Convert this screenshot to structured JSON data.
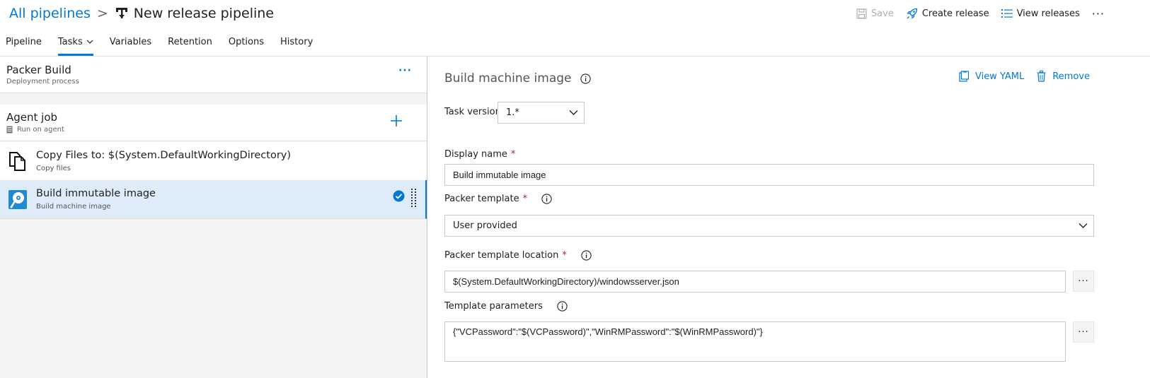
{
  "header": {
    "breadcrumb_root": "All pipelines",
    "breadcrumb_sep": ">",
    "title": "New release pipeline",
    "commands": {
      "save": "Save",
      "create_release": "Create release",
      "view_releases": "View releases",
      "more": "···"
    },
    "tabs": [
      {
        "label": "Pipeline"
      },
      {
        "label": "Tasks",
        "active": true
      },
      {
        "label": "Variables"
      },
      {
        "label": "Retention"
      },
      {
        "label": "Options"
      },
      {
        "label": "History"
      }
    ]
  },
  "left": {
    "process": {
      "title": "Packer Build",
      "subtitle": "Deployment process",
      "more": "···"
    },
    "agent_job": {
      "title": "Agent job",
      "subtitle": "Run on agent"
    },
    "tasks": [
      {
        "title": "Copy Files to: $(System.DefaultWorkingDirectory)",
        "subtitle": "Copy files"
      },
      {
        "title": "Build immutable image",
        "subtitle": "Build machine image",
        "selected": true
      }
    ]
  },
  "right": {
    "title": "Build machine image",
    "view_yaml": "View YAML",
    "remove": "Remove",
    "task_version_label": "Task version",
    "task_version": "1.*",
    "display_name_label": "Display name",
    "display_name": "Build immutable image",
    "packer_template_label": "Packer template",
    "packer_template": "User provided",
    "template_location_label": "Packer template location",
    "template_location": "$(System.DefaultWorkingDirectory)/windowsserver.json",
    "template_params_label": "Template parameters",
    "template_params": "{\"VCPassword\":\"$(VCPassword)\",\"WinRMPassword\":\"$(WinRMPassword)\"}",
    "required_mark": "*",
    "ellipsis": "···"
  },
  "colors": {
    "accent": "#0078d4",
    "selected_row": "#deecf9",
    "pane_bg": "#f4f4f4",
    "required": "#a4262c"
  },
  "icons": {
    "pipeline": "release-pipeline-icon",
    "save": "save-disk-icon",
    "create_release": "rocket-icon",
    "view_releases": "list-icon",
    "copy_files": "copy-files-icon",
    "packer": "packer-disk-icon",
    "check": "check-circle-icon",
    "view_yaml": "clipboard-icon",
    "remove": "trash-icon"
  }
}
